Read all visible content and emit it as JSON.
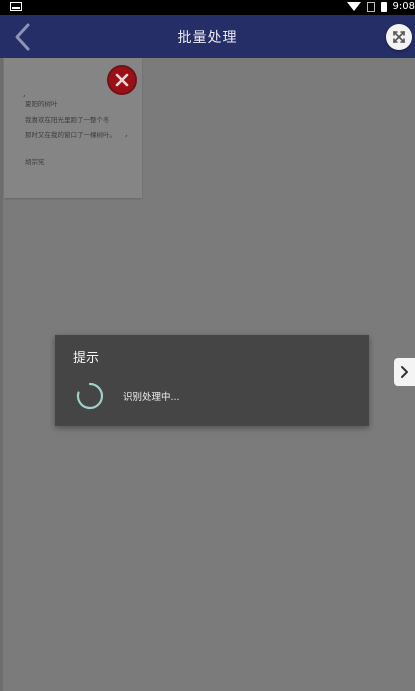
{
  "status_bar": {
    "time": "9:08"
  },
  "header": {
    "title": "批量处理"
  },
  "note": {
    "lines": [
      "夏阳的树叶",
      "我喜欢在阳光里跑了一整个冬",
      "那时又在我的窗口了一棵树叶。",
      "胡宗宪"
    ]
  },
  "dialog": {
    "title": "提示",
    "message": "识别处理中..."
  },
  "colors": {
    "header_bg": "#262e68",
    "overlay_bg": "#7b7b7b",
    "dialog_bg": "#454545",
    "spinner": "#9fd1cb",
    "delete_red": "#9b1016"
  }
}
